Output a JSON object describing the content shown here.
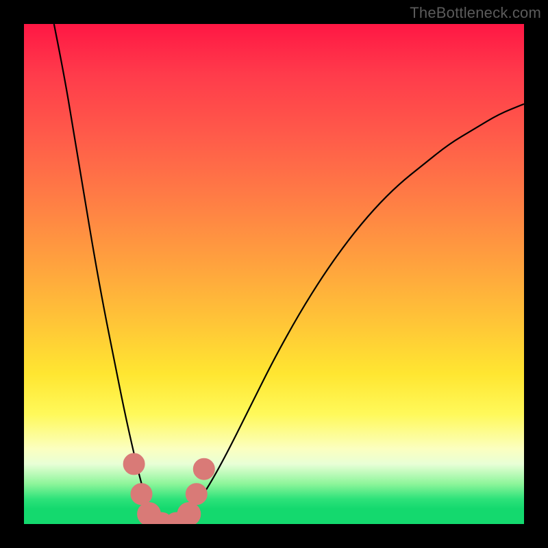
{
  "watermark": "TheBottleneck.com",
  "colors": {
    "frame": "#000000",
    "gradient_stops": [
      {
        "offset": 0.0,
        "hex": "#ff1744"
      },
      {
        "offset": 0.1,
        "hex": "#ff3b4b"
      },
      {
        "offset": 0.22,
        "hex": "#ff5a4a"
      },
      {
        "offset": 0.35,
        "hex": "#ff7d45"
      },
      {
        "offset": 0.48,
        "hex": "#ffa23e"
      },
      {
        "offset": 0.6,
        "hex": "#ffc637"
      },
      {
        "offset": 0.7,
        "hex": "#ffe631"
      },
      {
        "offset": 0.78,
        "hex": "#fff95a"
      },
      {
        "offset": 0.85,
        "hex": "#fbffc0"
      },
      {
        "offset": 0.88,
        "hex": "#e8ffd6"
      },
      {
        "offset": 0.92,
        "hex": "#8cf59a"
      },
      {
        "offset": 0.95,
        "hex": "#2de27a"
      },
      {
        "offset": 0.97,
        "hex": "#14d96e"
      },
      {
        "offset": 1.0,
        "hex": "#14d96e"
      }
    ],
    "curve": "#000000",
    "dot": "#d97a77"
  },
  "chart_data": {
    "type": "line",
    "title": "",
    "xlabel": "",
    "ylabel": "",
    "xlim": [
      0,
      100
    ],
    "ylim": [
      0,
      100
    ],
    "note": "Values estimated from the image: x is horizontal position 0–100 left→right, y is 0 at the green baseline and 100 at the top inside the colored plot.",
    "series": [
      {
        "name": "bottleneck-curve",
        "x": [
          6,
          8,
          10,
          12,
          14,
          16,
          18,
          20,
          22,
          23.5,
          25,
          27,
          29,
          31,
          33,
          36,
          40,
          45,
          50,
          55,
          60,
          65,
          70,
          75,
          80,
          85,
          90,
          95,
          100
        ],
        "y": [
          100,
          90,
          78,
          66,
          54,
          43,
          33,
          23,
          14,
          8,
          3,
          0.4,
          0,
          0.4,
          2,
          6,
          13,
          23,
          33,
          42,
          50,
          57,
          63,
          68,
          72,
          76,
          79,
          82,
          84
        ]
      }
    ],
    "markers": [
      {
        "name": "dot-left-upper",
        "x": 22.0,
        "y": 12.0,
        "r": 1.3
      },
      {
        "name": "dot-left-mid",
        "x": 23.5,
        "y": 6.0,
        "r": 1.3
      },
      {
        "name": "dot-left-low",
        "x": 25.0,
        "y": 2.0,
        "r": 1.5
      },
      {
        "name": "dot-bottom-l",
        "x": 27.5,
        "y": 0.0,
        "r": 1.5
      },
      {
        "name": "dot-bottom-r",
        "x": 30.5,
        "y": 0.0,
        "r": 1.5
      },
      {
        "name": "dot-right-low",
        "x": 33.0,
        "y": 2.0,
        "r": 1.5
      },
      {
        "name": "dot-right-mid",
        "x": 34.5,
        "y": 6.0,
        "r": 1.3
      },
      {
        "name": "dot-right-upper",
        "x": 36.0,
        "y": 11.0,
        "r": 1.3
      }
    ]
  }
}
